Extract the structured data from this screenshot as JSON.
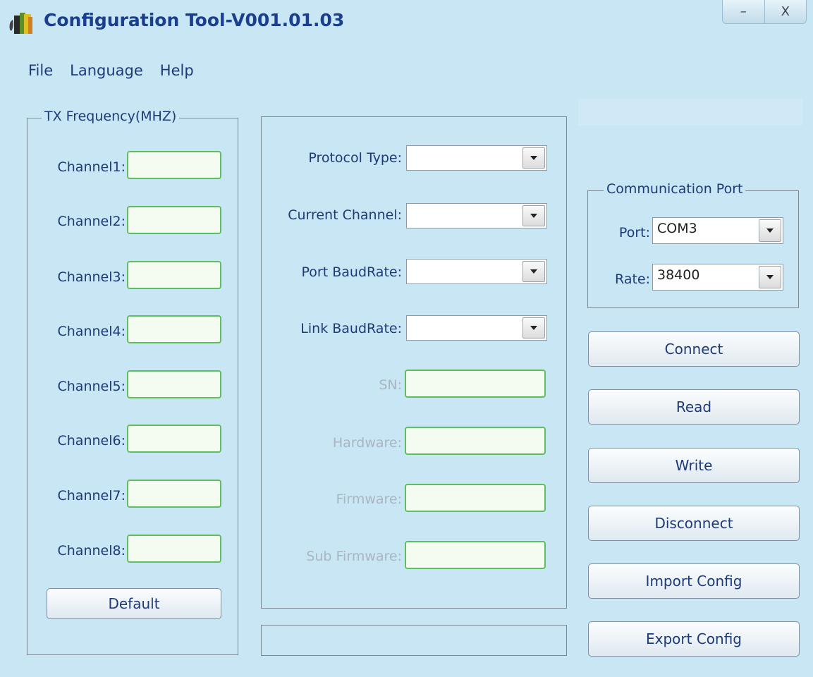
{
  "window": {
    "title": "Configuration Tool-V001.01.03",
    "minimize_glyph": "–",
    "close_glyph": "X"
  },
  "menu": [
    {
      "label": "File"
    },
    {
      "label": "Language"
    },
    {
      "label": "Help"
    }
  ],
  "tx_frequency": {
    "legend": "TX Frequency(MHZ)",
    "channels": [
      {
        "label": "Channel1:",
        "value": ""
      },
      {
        "label": "Channel2:",
        "value": ""
      },
      {
        "label": "Channel3:",
        "value": ""
      },
      {
        "label": "Channel4:",
        "value": ""
      },
      {
        "label": "Channel5:",
        "value": ""
      },
      {
        "label": "Channel6:",
        "value": ""
      },
      {
        "label": "Channel7:",
        "value": ""
      },
      {
        "label": "Channel8:",
        "value": ""
      }
    ],
    "default_button": "Default"
  },
  "settings": {
    "protocol_type": {
      "label": "Protocol Type:",
      "value": ""
    },
    "current_channel": {
      "label": "Current Channel:",
      "value": ""
    },
    "port_baudrate": {
      "label": "Port BaudRate:",
      "value": ""
    },
    "link_baudrate": {
      "label": "Link BaudRate:",
      "value": ""
    },
    "sn": {
      "label": "SN:",
      "value": ""
    },
    "hardware": {
      "label": "Hardware:",
      "value": ""
    },
    "firmware": {
      "label": "Firmware:",
      "value": ""
    },
    "sub_firmware": {
      "label": "Sub Firmware:",
      "value": ""
    }
  },
  "status_bar": {
    "text": ""
  },
  "communication_port": {
    "legend": "Communication Port",
    "port": {
      "label": "Port:",
      "value": "COM3"
    },
    "rate": {
      "label": "Rate:",
      "value": "38400"
    }
  },
  "actions": {
    "connect": "Connect",
    "read": "Read",
    "write": "Write",
    "disconnect": "Disconnect",
    "import_config": "Import Config",
    "export_config": "Export Config"
  },
  "colors": {
    "background": "#c9e6f4",
    "title_text": "#1b3f8f",
    "field_border": "#5fbf60",
    "label_text": "#1e3a78",
    "disabled_label": "#a9b6c2"
  },
  "icons": {
    "app": "app-icon",
    "dropdown": "chevron-down-icon"
  }
}
